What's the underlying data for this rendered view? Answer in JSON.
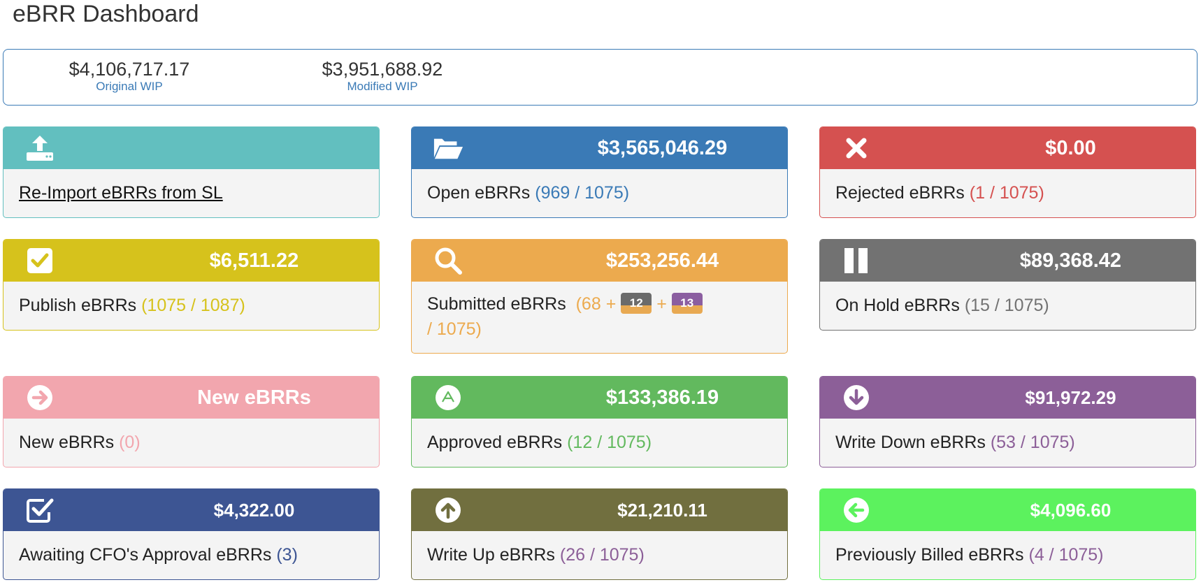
{
  "title": "eBRR Dashboard",
  "wip": {
    "original_amount": "$4,106,717.17",
    "original_label": "Original WIP",
    "modified_amount": "$3,951,688.92",
    "modified_label": "Modified WIP"
  },
  "cards": {
    "reimport": {
      "label": "Re-Import eBRRs from SL",
      "icon": "upload-icon",
      "color": "#62bfbf"
    },
    "open": {
      "amount": "$3,565,046.29",
      "label": "Open eBRRs",
      "count": "(969 / 1075)",
      "icon": "folder-open-icon",
      "color": "#3a7ab6"
    },
    "rejected": {
      "amount": "$0.00",
      "label": "Rejected eBRRs",
      "count": "(1 / 1075)",
      "icon": "x-icon",
      "color": "#d55150"
    },
    "publish": {
      "amount": "$6,511.22",
      "label": "Publish eBRRs",
      "count": "(1075 / 1087)",
      "icon": "checkbox-icon",
      "color": "#d6c21c"
    },
    "submitted": {
      "amount": "$253,256.44",
      "label": "Submitted eBRRs",
      "count_start": "(68 +",
      "badge1": "12",
      "plus": "+",
      "badge2": "13",
      "count_end": "/ 1075)",
      "icon": "search-icon",
      "color": "#ecaa4e"
    },
    "onhold": {
      "amount": "$89,368.42",
      "label": "On Hold eBRRs",
      "count": "(15 / 1075)",
      "icon": "pause-icon",
      "color": "#727272"
    },
    "new": {
      "amount": "New eBRRs",
      "label": "New eBRRs",
      "count": "(0)",
      "icon": "arrow-right-circle-icon",
      "color": "#f2a6ae"
    },
    "approved": {
      "amount": "$133,386.19",
      "label": "Approved eBRRs",
      "count": "(12 / 1075)",
      "icon": "triangle-up-circle-icon",
      "color": "#62b95e"
    },
    "writedown": {
      "amount": "$91,972.29",
      "label": "Write Down eBRRs",
      "count": "(53 / 1075)",
      "icon": "arrow-down-circle-icon",
      "color": "#8c5f98"
    },
    "cfo": {
      "amount": "$4,322.00",
      "label": "Awaiting CFO's Approval eBRRs",
      "count": "(3)",
      "icon": "check-square-icon",
      "color": "#3d5593"
    },
    "writeup": {
      "amount": "$21,210.11",
      "label": "Write Up eBRRs",
      "count": "(26 / 1075)",
      "icon": "arrow-up-circle-icon",
      "color": "#716f3f"
    },
    "prevbilled": {
      "amount": "$4,096.60",
      "label": "Previously Billed eBRRs",
      "count": "(4 / 1075)",
      "icon": "arrow-left-circle-icon",
      "color": "#5cf25e"
    }
  }
}
